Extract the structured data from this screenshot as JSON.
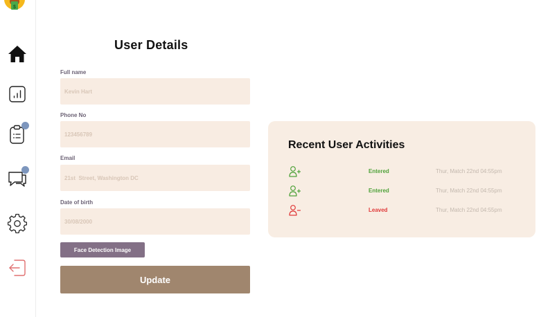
{
  "sidebar": {
    "avatar": "money-mouth-face-emoji",
    "items": [
      {
        "icon": "home-icon",
        "active": true
      },
      {
        "icon": "bar-chart-icon",
        "active": false
      },
      {
        "icon": "clipboard-icon",
        "active": false,
        "badge": true
      },
      {
        "icon": "chat-icon",
        "active": false,
        "badge": true
      },
      {
        "icon": "gear-icon",
        "active": false
      },
      {
        "icon": "logout-icon",
        "active": false
      }
    ],
    "badge_color": "#7d96bd",
    "logout_color": "#e07070"
  },
  "form": {
    "title": "User Details",
    "fields": [
      {
        "label": "Full name",
        "value": "Kevin Hart"
      },
      {
        "label": "Phone No",
        "value": "123456789"
      },
      {
        "label": "Email",
        "value": "21st  Street, Washington DC"
      },
      {
        "label": "Date of birth",
        "value": "30/08/2000"
      }
    ],
    "face_button": "Face Detection Image",
    "update_button": "Update",
    "field_bg": "#f8ece2",
    "face_btn_color": "#837086",
    "update_btn_color": "#a0866e"
  },
  "activities": {
    "title": "Recent User Activities",
    "items": [
      {
        "icon": "user-add-icon",
        "status": "Entered",
        "time": "Thur, Match 22nd 04:55pm",
        "color": "#4fa23a"
      },
      {
        "icon": "user-add-icon",
        "status": "Entered",
        "time": "Thur, Match 22nd 04:55pm",
        "color": "#4fa23a"
      },
      {
        "icon": "user-remove-icon",
        "status": "Leaved",
        "time": "Thur, Match 22nd 04:55pm",
        "color": "#e03a3a"
      }
    ],
    "panel_bg": "#f8ede3"
  }
}
